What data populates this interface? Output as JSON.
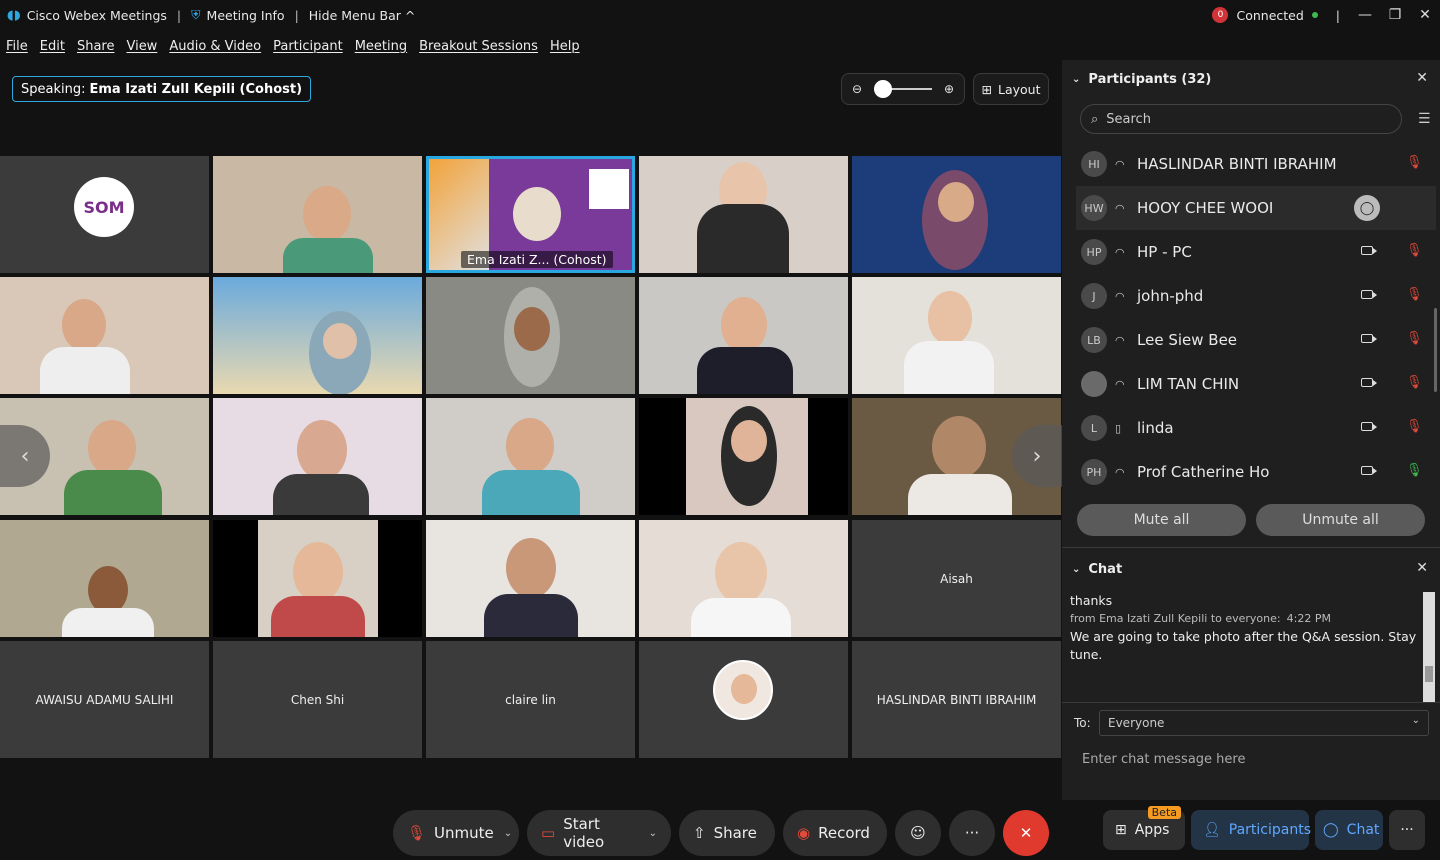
{
  "titlebar": {
    "app_name": "Cisco Webex Meetings",
    "meeting_info": "Meeting Info",
    "hide_menu": "Hide Menu Bar",
    "status_count": "0",
    "connected": "Connected"
  },
  "menu": [
    "File",
    "Edit",
    "Share",
    "View",
    "Audio & Video",
    "Participant",
    "Meeting",
    "Breakout Sessions",
    "Help"
  ],
  "speaking": {
    "label": "Speaking:",
    "name": "Ema Izati Zull Kepili (Cohost)"
  },
  "layout_label": "Layout",
  "zoom": {
    "level": 0.1
  },
  "grid": {
    "active_caption": "Ema Izati Z...  (Cohost)",
    "name_tiles": [
      "Aisah",
      "AWAISU ADAMU SALIHI",
      "Chen Shi",
      "claire lin",
      "HASLINDAR BINTI IBRAHIM"
    ],
    "logo_text": "SOM"
  },
  "controls": {
    "unmute": "Unmute",
    "start_video": "Start video",
    "share": "Share",
    "record": "Record",
    "apps": "Apps",
    "beta": "Beta",
    "participants": "Participants",
    "chat": "Chat"
  },
  "participants_panel": {
    "title": "Participants (32)",
    "search_placeholder": "Search",
    "mute_all": "Mute all",
    "unmute_all": "Unmute all",
    "rows": [
      {
        "initials": "HI",
        "name": "HASLINDAR BINTI IBRAHIM",
        "video": false,
        "mic": "muted"
      },
      {
        "initials": "HW",
        "name": "HOOY CHEE WOOI",
        "video": false,
        "mic": "none"
      },
      {
        "initials": "HP",
        "name": "HP - PC",
        "video": true,
        "mic": "muted"
      },
      {
        "initials": "J",
        "name": "john-phd",
        "video": true,
        "mic": "muted"
      },
      {
        "initials": "LB",
        "name": "Lee Siew Bee",
        "video": true,
        "mic": "muted"
      },
      {
        "initials": "",
        "name": "LIM TAN CHIN",
        "video": true,
        "mic": "muted"
      },
      {
        "initials": "L",
        "name": "linda",
        "video": true,
        "mic": "muted"
      },
      {
        "initials": "PH",
        "name": "Prof Catherine Ho",
        "video": true,
        "mic": "on"
      }
    ]
  },
  "chat": {
    "title": "Chat",
    "prev_message": "thanks",
    "from": "from Ema Izati Zull Kepili to everyone:",
    "time": "4:22 PM",
    "message": "We are going to take photo after the Q&A session. Stay tune.",
    "to_label": "To:",
    "to_value": "Everyone",
    "input_placeholder": "Enter chat message here"
  }
}
